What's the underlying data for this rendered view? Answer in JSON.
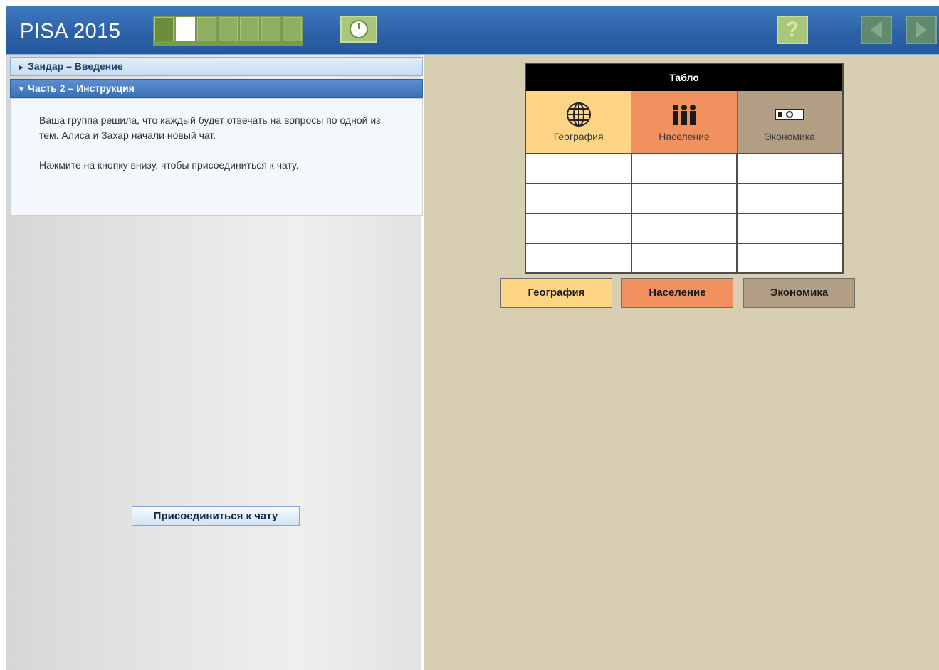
{
  "header": {
    "app_title": "PISA 2015",
    "progress": {
      "total_units": 7,
      "current_unit": 2
    },
    "icons": {
      "timer": "clock-icon",
      "help": "question-mark-icon",
      "back": "arrow-left-icon",
      "forward": "arrow-right-icon"
    },
    "help_label": "?"
  },
  "sidebar": {
    "sections": [
      {
        "label": "Зандар – Введение",
        "expanded": false
      },
      {
        "label": "Часть 2 – Инструкция",
        "expanded": true
      }
    ],
    "instructions": [
      "Ваша группа решила, что каждый будет отвечать на вопросы по одной из тем. Алиса и Захар начали новый чат.",
      "Нажмите на кнопку внизу, чтобы присоединиться к чату."
    ],
    "join_button": "Присоединиться к чату"
  },
  "board": {
    "title": "Табло",
    "columns": [
      {
        "label": "География",
        "icon": "globe-icon",
        "color": "#fdd584"
      },
      {
        "label": "Население",
        "icon": "people-icon",
        "color": "#f0915f"
      },
      {
        "label": "Экономика",
        "icon": "banknote-icon",
        "color": "#b29d85"
      }
    ],
    "rows": [
      [
        "",
        "",
        ""
      ],
      [
        "",
        "",
        ""
      ],
      [
        "",
        "",
        ""
      ],
      [
        "",
        "",
        ""
      ]
    ]
  },
  "topic_buttons": [
    "География",
    "Население",
    "Экономика"
  ]
}
